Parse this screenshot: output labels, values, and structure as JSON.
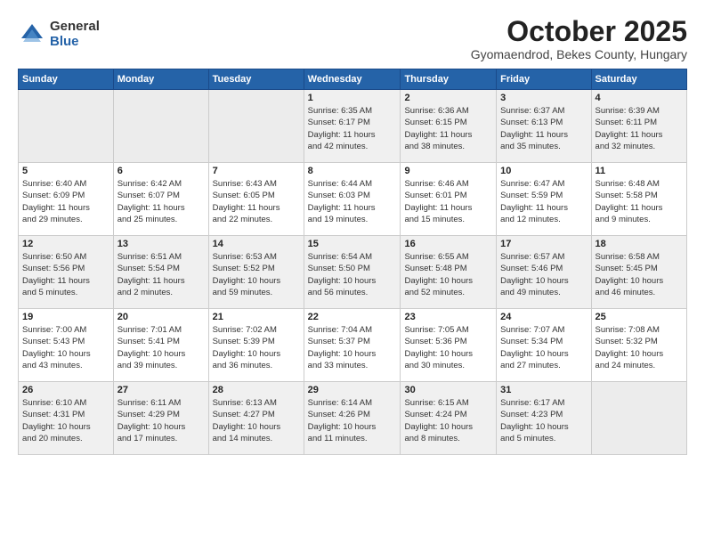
{
  "logo": {
    "general": "General",
    "blue": "Blue"
  },
  "header": {
    "month": "October 2025",
    "location": "Gyomaendrod, Bekes County, Hungary"
  },
  "weekdays": [
    "Sunday",
    "Monday",
    "Tuesday",
    "Wednesday",
    "Thursday",
    "Friday",
    "Saturday"
  ],
  "weeks": [
    [
      {
        "day": "",
        "info": ""
      },
      {
        "day": "",
        "info": ""
      },
      {
        "day": "",
        "info": ""
      },
      {
        "day": "1",
        "info": "Sunrise: 6:35 AM\nSunset: 6:17 PM\nDaylight: 11 hours\nand 42 minutes."
      },
      {
        "day": "2",
        "info": "Sunrise: 6:36 AM\nSunset: 6:15 PM\nDaylight: 11 hours\nand 38 minutes."
      },
      {
        "day": "3",
        "info": "Sunrise: 6:37 AM\nSunset: 6:13 PM\nDaylight: 11 hours\nand 35 minutes."
      },
      {
        "day": "4",
        "info": "Sunrise: 6:39 AM\nSunset: 6:11 PM\nDaylight: 11 hours\nand 32 minutes."
      }
    ],
    [
      {
        "day": "5",
        "info": "Sunrise: 6:40 AM\nSunset: 6:09 PM\nDaylight: 11 hours\nand 29 minutes."
      },
      {
        "day": "6",
        "info": "Sunrise: 6:42 AM\nSunset: 6:07 PM\nDaylight: 11 hours\nand 25 minutes."
      },
      {
        "day": "7",
        "info": "Sunrise: 6:43 AM\nSunset: 6:05 PM\nDaylight: 11 hours\nand 22 minutes."
      },
      {
        "day": "8",
        "info": "Sunrise: 6:44 AM\nSunset: 6:03 PM\nDaylight: 11 hours\nand 19 minutes."
      },
      {
        "day": "9",
        "info": "Sunrise: 6:46 AM\nSunset: 6:01 PM\nDaylight: 11 hours\nand 15 minutes."
      },
      {
        "day": "10",
        "info": "Sunrise: 6:47 AM\nSunset: 5:59 PM\nDaylight: 11 hours\nand 12 minutes."
      },
      {
        "day": "11",
        "info": "Sunrise: 6:48 AM\nSunset: 5:58 PM\nDaylight: 11 hours\nand 9 minutes."
      }
    ],
    [
      {
        "day": "12",
        "info": "Sunrise: 6:50 AM\nSunset: 5:56 PM\nDaylight: 11 hours\nand 5 minutes."
      },
      {
        "day": "13",
        "info": "Sunrise: 6:51 AM\nSunset: 5:54 PM\nDaylight: 11 hours\nand 2 minutes."
      },
      {
        "day": "14",
        "info": "Sunrise: 6:53 AM\nSunset: 5:52 PM\nDaylight: 10 hours\nand 59 minutes."
      },
      {
        "day": "15",
        "info": "Sunrise: 6:54 AM\nSunset: 5:50 PM\nDaylight: 10 hours\nand 56 minutes."
      },
      {
        "day": "16",
        "info": "Sunrise: 6:55 AM\nSunset: 5:48 PM\nDaylight: 10 hours\nand 52 minutes."
      },
      {
        "day": "17",
        "info": "Sunrise: 6:57 AM\nSunset: 5:46 PM\nDaylight: 10 hours\nand 49 minutes."
      },
      {
        "day": "18",
        "info": "Sunrise: 6:58 AM\nSunset: 5:45 PM\nDaylight: 10 hours\nand 46 minutes."
      }
    ],
    [
      {
        "day": "19",
        "info": "Sunrise: 7:00 AM\nSunset: 5:43 PM\nDaylight: 10 hours\nand 43 minutes."
      },
      {
        "day": "20",
        "info": "Sunrise: 7:01 AM\nSunset: 5:41 PM\nDaylight: 10 hours\nand 39 minutes."
      },
      {
        "day": "21",
        "info": "Sunrise: 7:02 AM\nSunset: 5:39 PM\nDaylight: 10 hours\nand 36 minutes."
      },
      {
        "day": "22",
        "info": "Sunrise: 7:04 AM\nSunset: 5:37 PM\nDaylight: 10 hours\nand 33 minutes."
      },
      {
        "day": "23",
        "info": "Sunrise: 7:05 AM\nSunset: 5:36 PM\nDaylight: 10 hours\nand 30 minutes."
      },
      {
        "day": "24",
        "info": "Sunrise: 7:07 AM\nSunset: 5:34 PM\nDaylight: 10 hours\nand 27 minutes."
      },
      {
        "day": "25",
        "info": "Sunrise: 7:08 AM\nSunset: 5:32 PM\nDaylight: 10 hours\nand 24 minutes."
      }
    ],
    [
      {
        "day": "26",
        "info": "Sunrise: 6:10 AM\nSunset: 4:31 PM\nDaylight: 10 hours\nand 20 minutes."
      },
      {
        "day": "27",
        "info": "Sunrise: 6:11 AM\nSunset: 4:29 PM\nDaylight: 10 hours\nand 17 minutes."
      },
      {
        "day": "28",
        "info": "Sunrise: 6:13 AM\nSunset: 4:27 PM\nDaylight: 10 hours\nand 14 minutes."
      },
      {
        "day": "29",
        "info": "Sunrise: 6:14 AM\nSunset: 4:26 PM\nDaylight: 10 hours\nand 11 minutes."
      },
      {
        "day": "30",
        "info": "Sunrise: 6:15 AM\nSunset: 4:24 PM\nDaylight: 10 hours\nand 8 minutes."
      },
      {
        "day": "31",
        "info": "Sunrise: 6:17 AM\nSunset: 4:23 PM\nDaylight: 10 hours\nand 5 minutes."
      },
      {
        "day": "",
        "info": ""
      }
    ]
  ]
}
